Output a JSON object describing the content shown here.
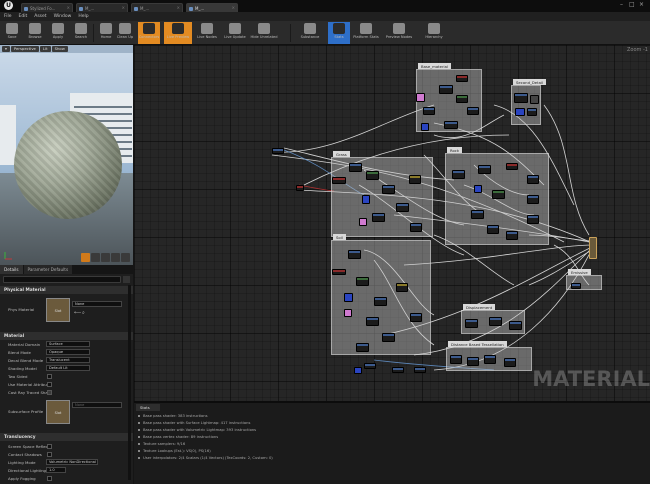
{
  "window": {
    "tabs": [
      "Stylized Fo...",
      "M_...",
      "M_...",
      "M_..."
    ],
    "active_tab_index": 3
  },
  "menu": [
    "File",
    "Edit",
    "Asset",
    "Window",
    "Help"
  ],
  "toolbar": [
    {
      "label": "Save",
      "icon": "save-icon"
    },
    {
      "label": "Browse",
      "icon": "browse-icon"
    },
    {
      "label": "Apply",
      "icon": "apply-icon"
    },
    {
      "label": "Search",
      "icon": "search-icon"
    },
    {
      "label": "Home",
      "icon": "home-icon"
    },
    {
      "label": "Clean Up",
      "icon": "clean-up-icon"
    },
    {
      "label": "Connectors",
      "icon": "connectors-icon"
    },
    {
      "label": "Live Preview",
      "icon": "live-preview-icon"
    },
    {
      "label": "Live Nodes",
      "icon": "live-nodes-icon"
    },
    {
      "label": "Live Update",
      "icon": "live-update-icon"
    },
    {
      "label": "Hide Unrelated",
      "icon": "hide-unrelated-icon"
    },
    {
      "label": "Substance",
      "icon": "substance-icon"
    },
    {
      "label": "Stats",
      "icon": "stats-icon"
    },
    {
      "label": "Platform Stats",
      "icon": "platform-stats-icon"
    },
    {
      "label": "Preview Nodes",
      "icon": "preview-nodes-icon"
    },
    {
      "label": "Hierarchy",
      "icon": "hierarchy-icon"
    }
  ],
  "viewport": {
    "buttons": [
      "Perspective",
      "Lit",
      "Show"
    ]
  },
  "details": {
    "tabs": [
      "Details",
      "Parameter Defaults"
    ],
    "sections": {
      "physical_material": "Physical Material",
      "material": "Material",
      "translucency": "Translucency"
    },
    "phys_material_label": "Phys Material",
    "phys_material_value": "None",
    "phys_material_thumb": "Slot",
    "props": [
      {
        "label": "Material Domain",
        "value": "Surface"
      },
      {
        "label": "Blend Mode",
        "value": "Opaque"
      },
      {
        "label": "Decal Blend Mode",
        "value": "Translucent"
      },
      {
        "label": "Shading Model",
        "value": "Default Lit"
      },
      {
        "label": "Two Sided",
        "value": ""
      },
      {
        "label": "Use Material Attribut",
        "value": ""
      },
      {
        "label": "Cast Ray Traced Sha",
        "value": ""
      }
    ],
    "subsurface_label": "Subsurface Profile",
    "subsurface_value": "None",
    "subsurface_thumb": "Slot",
    "translucency_props": [
      {
        "label": "Screen Space Reflecti",
        "value": ""
      },
      {
        "label": "Contact Shadows",
        "value": ""
      },
      {
        "label": "Lighting Mode",
        "value": "Volumetric NonDirectional"
      },
      {
        "label": "Directional Lighting I",
        "value": "1.0"
      },
      {
        "label": "Apply Fogging",
        "value": ""
      }
    ]
  },
  "graph": {
    "zoom": "Zoom -1",
    "watermark": "MATERIAL",
    "comments": [
      {
        "label": "Base_material"
      },
      {
        "label": "Second_Detail"
      },
      {
        "label": "Grass"
      },
      {
        "label": "Soil"
      },
      {
        "label": "Rock"
      },
      {
        "label": "Emissive"
      },
      {
        "label": "Displacement"
      },
      {
        "label": "Distance Based Tessellation"
      }
    ]
  },
  "stats": {
    "tab": "Stats",
    "lines": [
      "Base pass shader: 383 instructions",
      "Base pass shader with Surface Lightmap: 417 instructions",
      "Base pass shader with Volumetric Lightmap: 393 instructions",
      "Base pass vertex shader: 89 instructions",
      "Texture samplers: 9/16",
      "Texture Lookups (Est.): VS(0), PS(16)",
      "User interpolators: 2/4 Scalars (1/4 Vectors) (TexCoords: 2, Custom: 0)"
    ]
  }
}
